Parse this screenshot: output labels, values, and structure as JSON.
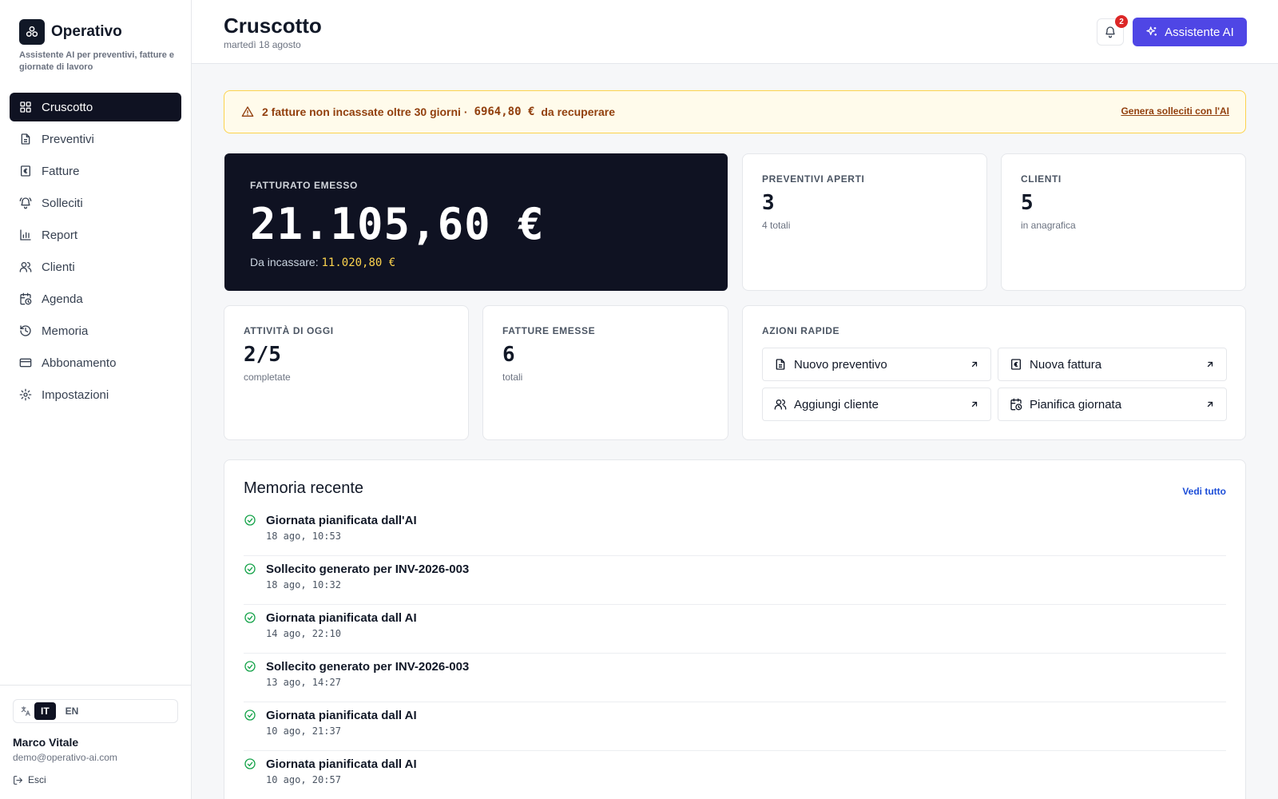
{
  "app": {
    "name": "Operativo",
    "tagline": "Assistente AI per preventivi, fatture e giornate di lavoro"
  },
  "sidebar": {
    "items": [
      {
        "label": "Cruscotto",
        "icon": "dashboard-icon",
        "active": true
      },
      {
        "label": "Preventivi",
        "icon": "document-icon"
      },
      {
        "label": "Fatture",
        "icon": "invoice-euro-icon"
      },
      {
        "label": "Solleciti",
        "icon": "bell-ring-icon"
      },
      {
        "label": "Report",
        "icon": "bar-chart-icon"
      },
      {
        "label": "Clienti",
        "icon": "users-icon"
      },
      {
        "label": "Agenda",
        "icon": "calendar-clock-icon"
      },
      {
        "label": "Memoria",
        "icon": "history-icon"
      },
      {
        "label": "Abbonamento",
        "icon": "credit-card-icon"
      },
      {
        "label": "Impostazioni",
        "icon": "gear-icon"
      }
    ],
    "languages": [
      "IT",
      "EN"
    ],
    "active_language": "IT",
    "user": {
      "name": "Marco Vitale",
      "email": "demo@operativo-ai.com"
    },
    "logout_label": "Esci"
  },
  "header": {
    "title": "Cruscotto",
    "date": "martedì 18 agosto",
    "notifications_count": "2",
    "ai_button_label": "Assistente AI"
  },
  "alert": {
    "text_before": "2 fatture non incassate oltre 30 giorni ·",
    "amount": "6964,80 €",
    "text_after": "da recuperare",
    "action_label": "Genera solleciti con l'AI",
    "color": "#92400e"
  },
  "stats": {
    "revenue": {
      "label": "Fatturato emesso",
      "value": "21.105,60 €",
      "sub_label": "Da incassare:",
      "sub_value": "11.020,80 €"
    },
    "open_quotes": {
      "label": "Preventivi aperti",
      "value": "3",
      "sub": "4 totali"
    },
    "clients": {
      "label": "Clienti",
      "value": "5",
      "sub": "in anagrafica"
    },
    "today_activities": {
      "label": "Attività di oggi",
      "value": "2/5",
      "sub": "completate"
    },
    "invoices_issued": {
      "label": "Fatture emesse",
      "value": "6",
      "sub": "totali"
    }
  },
  "quick_actions": {
    "label": "Azioni rapide",
    "items": [
      {
        "label": "Nuovo preventivo",
        "icon": "document-icon"
      },
      {
        "label": "Nuova fattura",
        "icon": "invoice-euro-icon"
      },
      {
        "label": "Aggiungi cliente",
        "icon": "users-icon"
      },
      {
        "label": "Pianifica giornata",
        "icon": "calendar-clock-icon"
      }
    ]
  },
  "memory": {
    "title": "Memoria recente",
    "link_label": "Vedi tutto",
    "items": [
      {
        "title": "Giornata pianificata dall'AI",
        "time": "18 ago, 10:53"
      },
      {
        "title": "Sollecito generato per INV-2026-003",
        "time": "18 ago, 10:32"
      },
      {
        "title": "Giornata pianificata dall AI",
        "time": "14 ago, 22:10"
      },
      {
        "title": "Sollecito generato per INV-2026-003",
        "time": "13 ago, 14:27"
      },
      {
        "title": "Giornata pianificata dall AI",
        "time": "10 ago, 21:37"
      },
      {
        "title": "Giornata pianificata dall AI",
        "time": "10 ago, 20:57"
      }
    ]
  },
  "colors": {
    "accent": "#4f46e5",
    "dark": "#0f1222",
    "success": "#16a34a",
    "warning_bg": "#fffbeb"
  }
}
